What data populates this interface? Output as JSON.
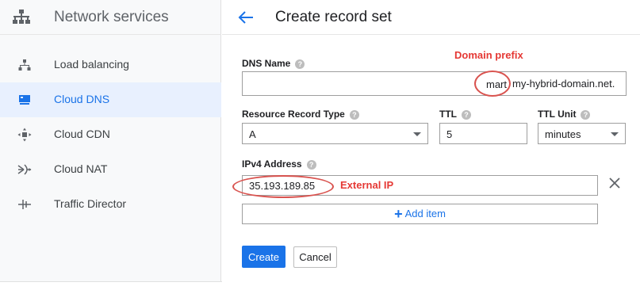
{
  "sidebar": {
    "title": "Network services",
    "logo_icon": "network-services-icon",
    "items": [
      {
        "label": "Load balancing",
        "icon": "load-balancing-icon",
        "active": false
      },
      {
        "label": "Cloud DNS",
        "icon": "cloud-dns-icon",
        "active": true
      },
      {
        "label": "Cloud CDN",
        "icon": "cloud-cdn-icon",
        "active": false
      },
      {
        "label": "Cloud NAT",
        "icon": "cloud-nat-icon",
        "active": false
      },
      {
        "label": "Traffic Director",
        "icon": "traffic-director-icon",
        "active": false
      }
    ]
  },
  "header": {
    "back_icon": "arrow-back-icon",
    "title": "Create record set"
  },
  "form": {
    "dns_name": {
      "label": "DNS Name",
      "value": "mart",
      "suffix": "my-hybrid-domain.net."
    },
    "record_type": {
      "label": "Resource Record Type",
      "value": "A"
    },
    "ttl": {
      "label": "TTL",
      "value": "5"
    },
    "ttl_unit": {
      "label": "TTL Unit",
      "value": "minutes"
    },
    "ipv4": {
      "label": "IPv4 Address",
      "value": "35.193.189.85"
    },
    "add_item_label": "Add item",
    "help_glyph": "?"
  },
  "annotations": {
    "domain_prefix": "Domain prefix",
    "external_ip": "External IP"
  },
  "buttons": {
    "create": "Create",
    "cancel": "Cancel"
  },
  "colors": {
    "accent": "#1a73e8",
    "annotation": "#e53935",
    "active_bg": "#e8f0fe"
  }
}
